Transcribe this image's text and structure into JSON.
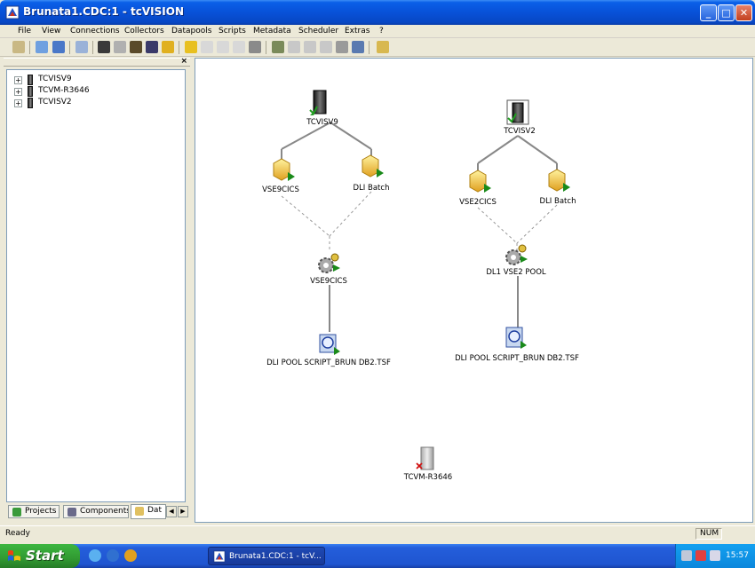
{
  "window": {
    "title": "Brunata1.CDC:1 - tcVISION"
  },
  "menu": [
    "File",
    "View",
    "Connections",
    "Collectors",
    "Datapools",
    "Scripts",
    "Metadata",
    "Scheduler",
    "Extras",
    "?"
  ],
  "tree": [
    {
      "label": "TCVISV9"
    },
    {
      "label": "TCVM-R3646"
    },
    {
      "label": "TCVISV2"
    }
  ],
  "tabs": [
    "Projects",
    "Components",
    "Dat"
  ],
  "graph": {
    "left": {
      "server": "TCVISV9",
      "source1": "VSE9CICS",
      "source2": "DLI Batch",
      "collector": "VSE9CICS",
      "script": "DLI POOL SCRIPT_BRUN DB2.TSF"
    },
    "right": {
      "server": "TCVISV2",
      "source1": "VSE2CICS",
      "source2": "DLI Batch",
      "collector": "DL1 VSE2 POOL",
      "script": "DLI POOL SCRIPT_BRUN DB2.TSF"
    },
    "lone_server": "TCVM-R3646"
  },
  "status": {
    "text": "Ready",
    "num": "NUM"
  },
  "taskbar": {
    "start": "Start",
    "item": "Brunata1.CDC:1 - tcV...",
    "clock": "15:57"
  }
}
